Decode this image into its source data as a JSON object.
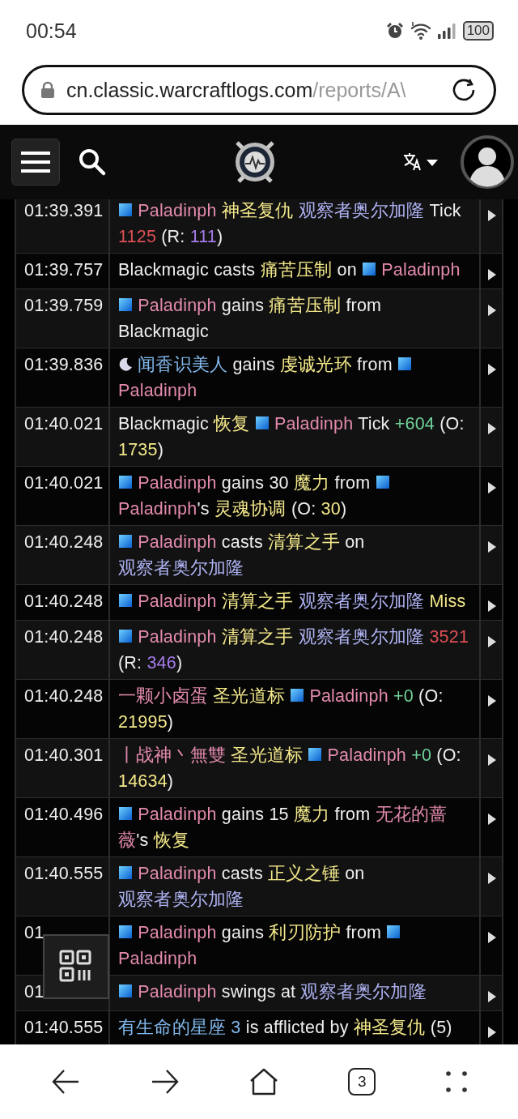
{
  "status_bar": {
    "time": "00:54",
    "battery": "100"
  },
  "address_bar": {
    "host": "cn.classic.warcraftlogs.com",
    "path": "/reports/A\\"
  },
  "log": {
    "rows": [
      {
        "time": "01:39.391",
        "segments": [
          {
            "kind": "paladin",
            "text": "Paladinph"
          },
          {
            "kind": "spell",
            "text": "神圣复仇"
          },
          {
            "kind": "enemy",
            "text": "观察者奥尔加隆"
          },
          {
            "kind": "plain",
            "text": "Tick"
          },
          {
            "kind": "damage",
            "text": "1125"
          },
          {
            "kind": "plain",
            "text": "(R:"
          },
          {
            "kind": "resist",
            "text": "111"
          },
          {
            "kind": "tail",
            "text": ")"
          }
        ]
      },
      {
        "time": "01:39.757",
        "segments": [
          {
            "kind": "plain",
            "text": "Blackmagic"
          },
          {
            "kind": "plain",
            "text": "casts"
          },
          {
            "kind": "spell",
            "text": "痛苦压制"
          },
          {
            "kind": "plain",
            "text": "on"
          },
          {
            "kind": "paladin",
            "text": "Paladinph"
          }
        ]
      },
      {
        "time": "01:39.759",
        "segments": [
          {
            "kind": "paladin",
            "text": "Paladinph"
          },
          {
            "kind": "plain",
            "text": "gains"
          },
          {
            "kind": "spell",
            "text": "痛苦压制"
          },
          {
            "kind": "plain",
            "text": "from"
          },
          {
            "kind": "plain",
            "text": "Blackmagic"
          }
        ]
      },
      {
        "time": "01:39.836",
        "segments": [
          {
            "kind": "druid",
            "text": "闻香识美人"
          },
          {
            "kind": "plain",
            "text": "gains"
          },
          {
            "kind": "spell",
            "text": "虔诚光环"
          },
          {
            "kind": "plain",
            "text": "from"
          },
          {
            "kind": "paladin",
            "text": "Paladinph"
          }
        ]
      },
      {
        "time": "01:40.021",
        "segments": [
          {
            "kind": "plain",
            "text": "Blackmagic"
          },
          {
            "kind": "spell",
            "text": "恢复"
          },
          {
            "kind": "paladin",
            "text": "Paladinph"
          },
          {
            "kind": "plain",
            "text": "Tick"
          },
          {
            "kind": "heal",
            "text": "+604"
          },
          {
            "kind": "plain",
            "text": "(O:"
          },
          {
            "kind": "number",
            "text": "1735"
          },
          {
            "kind": "tail",
            "text": ")"
          }
        ]
      },
      {
        "time": "01:40.021",
        "segments": [
          {
            "kind": "paladin",
            "text": "Paladinph"
          },
          {
            "kind": "plain",
            "text": "gains"
          },
          {
            "kind": "plain",
            "text": "30"
          },
          {
            "kind": "spell",
            "text": "魔力"
          },
          {
            "kind": "plain",
            "text": "from"
          },
          {
            "kind": "paladin",
            "text": "Paladinph"
          },
          {
            "kind": "tail",
            "text": "'s"
          },
          {
            "kind": "spell",
            "text": "灵魂协调"
          },
          {
            "kind": "plain",
            "text": "(O:"
          },
          {
            "kind": "number",
            "text": "30"
          },
          {
            "kind": "tail",
            "text": ")"
          }
        ]
      },
      {
        "time": "01:40.248",
        "segments": [
          {
            "kind": "paladin",
            "text": "Paladinph"
          },
          {
            "kind": "plain",
            "text": "casts"
          },
          {
            "kind": "spell",
            "text": "清算之手"
          },
          {
            "kind": "plain",
            "text": "on"
          },
          {
            "kind": "enemy",
            "text": "观察者奥尔加"
          },
          {
            "kind": "enemy_tail",
            "text": "隆"
          }
        ]
      },
      {
        "time": "01:40.248",
        "segments": [
          {
            "kind": "paladin",
            "text": "Paladinph"
          },
          {
            "kind": "spell",
            "text": "清算之手"
          },
          {
            "kind": "enemy",
            "text": "观察者奥尔加隆"
          },
          {
            "kind": "number",
            "text": "Miss"
          }
        ]
      },
      {
        "time": "01:40.248",
        "segments": [
          {
            "kind": "paladin",
            "text": "Paladinph"
          },
          {
            "kind": "spell",
            "text": "清算之手"
          },
          {
            "kind": "enemy",
            "text": "观察者奥尔加隆"
          },
          {
            "kind": "damage",
            "text": "3521"
          },
          {
            "kind": "plain",
            "text": "(R:"
          },
          {
            "kind": "resist",
            "text": "346"
          },
          {
            "kind": "tail",
            "text": ")"
          }
        ]
      },
      {
        "time": "01:40.248",
        "segments": [
          {
            "kind": "pink",
            "text": "一颗小卤蛋"
          },
          {
            "kind": "spell",
            "text": "圣光道标"
          },
          {
            "kind": "paladin",
            "text": "Paladinph"
          },
          {
            "kind": "heal",
            "text": "+0"
          },
          {
            "kind": "plain",
            "text": "(O:"
          },
          {
            "kind": "number",
            "text": "21995"
          },
          {
            "kind": "tail",
            "text": ")"
          }
        ]
      },
      {
        "time": "01:40.301",
        "segments": [
          {
            "kind": "pink",
            "text": "丨战神丶無雙"
          },
          {
            "kind": "spell",
            "text": "圣光道标"
          },
          {
            "kind": "paladin",
            "text": "Paladinph"
          },
          {
            "kind": "heal",
            "text": "+0"
          },
          {
            "kind": "plain",
            "text": "(O:"
          },
          {
            "kind": "number",
            "text": "14634"
          },
          {
            "kind": "tail",
            "text": ")"
          }
        ]
      },
      {
        "time": "01:40.496",
        "segments": [
          {
            "kind": "paladin",
            "text": "Paladinph"
          },
          {
            "kind": "plain",
            "text": "gains"
          },
          {
            "kind": "plain",
            "text": "15"
          },
          {
            "kind": "spell",
            "text": "魔力"
          },
          {
            "kind": "plain",
            "text": "from"
          },
          {
            "kind": "pink",
            "text": "无花的蔷"
          },
          {
            "kind": "pink_tail",
            "text": "薇"
          },
          {
            "kind": "tail",
            "text": "'s"
          },
          {
            "kind": "spell",
            "text": "恢复"
          }
        ]
      },
      {
        "time": "01:40.555",
        "segments": [
          {
            "kind": "paladin",
            "text": "Paladinph"
          },
          {
            "kind": "plain",
            "text": "casts"
          },
          {
            "kind": "spell",
            "text": "正义之锤"
          },
          {
            "kind": "plain",
            "text": "on"
          },
          {
            "kind": "enemy",
            "text": "观察者奥尔加"
          },
          {
            "kind": "enemy_tail",
            "text": "隆"
          }
        ]
      },
      {
        "time": "01",
        "segments": [
          {
            "kind": "paladin",
            "text": "Paladinph"
          },
          {
            "kind": "plain",
            "text": "gains"
          },
          {
            "kind": "spell",
            "text": "利刃防护"
          },
          {
            "kind": "plain",
            "text": "from"
          },
          {
            "kind": "paladin",
            "text": "Paladinph"
          }
        ]
      },
      {
        "time": "01",
        "segments": [
          {
            "kind": "paladin",
            "text": "Paladinph"
          },
          {
            "kind": "plain",
            "text": "swings"
          },
          {
            "kind": "plain",
            "text": "at"
          },
          {
            "kind": "enemy",
            "text": "观察者奥尔加隆"
          }
        ]
      },
      {
        "time": "01:40.555",
        "segments": [
          {
            "kind": "friend",
            "text": "有生命的星座 3"
          },
          {
            "kind": "plain",
            "text": "is"
          },
          {
            "kind": "plain",
            "text": "afflicted"
          },
          {
            "kind": "plain",
            "text": "by"
          },
          {
            "kind": "spell",
            "text": "神圣复仇"
          },
          {
            "kind": "plain",
            "text": "(5)"
          }
        ]
      }
    ]
  },
  "bottom_bar": {
    "tab_count": "3"
  }
}
